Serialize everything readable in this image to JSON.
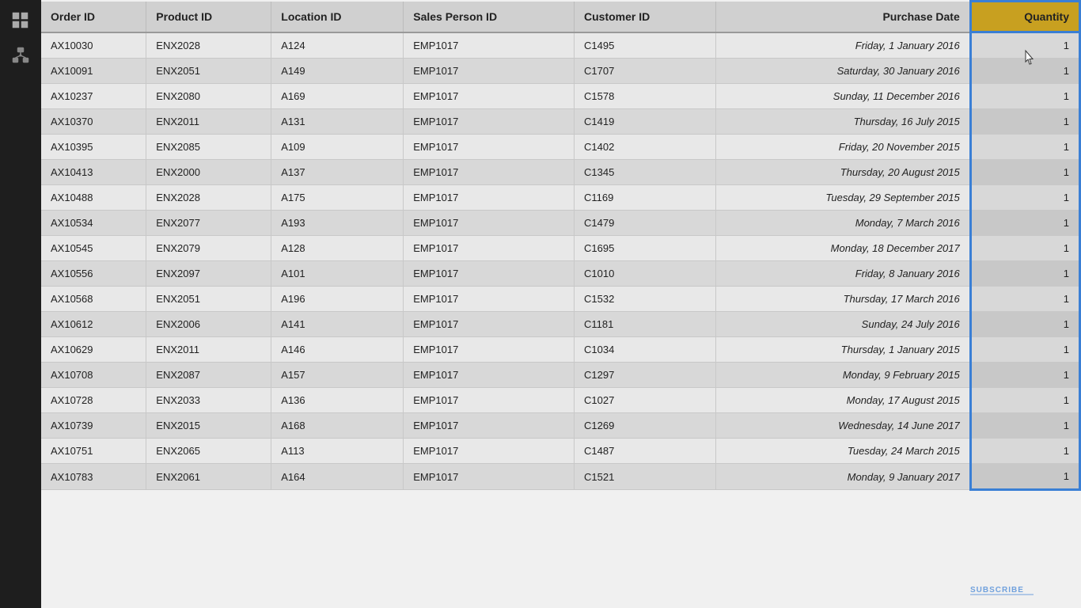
{
  "sidebar": {
    "icons": [
      {
        "name": "table-icon",
        "label": "Table View",
        "active": true
      },
      {
        "name": "network-icon",
        "label": "Network View",
        "active": false
      }
    ]
  },
  "table": {
    "columns": [
      {
        "key": "order_id",
        "label": "Order ID"
      },
      {
        "key": "product_id",
        "label": "Product ID"
      },
      {
        "key": "location_id",
        "label": "Location ID"
      },
      {
        "key": "sales_person_id",
        "label": "Sales Person ID"
      },
      {
        "key": "customer_id",
        "label": "Customer ID"
      },
      {
        "key": "purchase_date",
        "label": "Purchase Date"
      },
      {
        "key": "quantity",
        "label": "Quantity"
      }
    ],
    "rows": [
      {
        "order_id": "AX10030",
        "product_id": "ENX2028",
        "location_id": "A124",
        "sales_person_id": "EMP1017",
        "customer_id": "C1495",
        "purchase_date": "Friday, 1 January 2016",
        "quantity": "1"
      },
      {
        "order_id": "AX10091",
        "product_id": "ENX2051",
        "location_id": "A149",
        "sales_person_id": "EMP1017",
        "customer_id": "C1707",
        "purchase_date": "Saturday, 30 January 2016",
        "quantity": "1"
      },
      {
        "order_id": "AX10237",
        "product_id": "ENX2080",
        "location_id": "A169",
        "sales_person_id": "EMP1017",
        "customer_id": "C1578",
        "purchase_date": "Sunday, 11 December 2016",
        "quantity": "1"
      },
      {
        "order_id": "AX10370",
        "product_id": "ENX2011",
        "location_id": "A131",
        "sales_person_id": "EMP1017",
        "customer_id": "C1419",
        "purchase_date": "Thursday, 16 July 2015",
        "quantity": "1"
      },
      {
        "order_id": "AX10395",
        "product_id": "ENX2085",
        "location_id": "A109",
        "sales_person_id": "EMP1017",
        "customer_id": "C1402",
        "purchase_date": "Friday, 20 November 2015",
        "quantity": "1"
      },
      {
        "order_id": "AX10413",
        "product_id": "ENX2000",
        "location_id": "A137",
        "sales_person_id": "EMP1017",
        "customer_id": "C1345",
        "purchase_date": "Thursday, 20 August 2015",
        "quantity": "1"
      },
      {
        "order_id": "AX10488",
        "product_id": "ENX2028",
        "location_id": "A175",
        "sales_person_id": "EMP1017",
        "customer_id": "C1169",
        "purchase_date": "Tuesday, 29 September 2015",
        "quantity": "1"
      },
      {
        "order_id": "AX10534",
        "product_id": "ENX2077",
        "location_id": "A193",
        "sales_person_id": "EMP1017",
        "customer_id": "C1479",
        "purchase_date": "Monday, 7 March 2016",
        "quantity": "1"
      },
      {
        "order_id": "AX10545",
        "product_id": "ENX2079",
        "location_id": "A128",
        "sales_person_id": "EMP1017",
        "customer_id": "C1695",
        "purchase_date": "Monday, 18 December 2017",
        "quantity": "1"
      },
      {
        "order_id": "AX10556",
        "product_id": "ENX2097",
        "location_id": "A101",
        "sales_person_id": "EMP1017",
        "customer_id": "C1010",
        "purchase_date": "Friday, 8 January 2016",
        "quantity": "1"
      },
      {
        "order_id": "AX10568",
        "product_id": "ENX2051",
        "location_id": "A196",
        "sales_person_id": "EMP1017",
        "customer_id": "C1532",
        "purchase_date": "Thursday, 17 March 2016",
        "quantity": "1"
      },
      {
        "order_id": "AX10612",
        "product_id": "ENX2006",
        "location_id": "A141",
        "sales_person_id": "EMP1017",
        "customer_id": "C1181",
        "purchase_date": "Sunday, 24 July 2016",
        "quantity": "1"
      },
      {
        "order_id": "AX10629",
        "product_id": "ENX2011",
        "location_id": "A146",
        "sales_person_id": "EMP1017",
        "customer_id": "C1034",
        "purchase_date": "Thursday, 1 January 2015",
        "quantity": "1"
      },
      {
        "order_id": "AX10708",
        "product_id": "ENX2087",
        "location_id": "A157",
        "sales_person_id": "EMP1017",
        "customer_id": "C1297",
        "purchase_date": "Monday, 9 February 2015",
        "quantity": "1"
      },
      {
        "order_id": "AX10728",
        "product_id": "ENX2033",
        "location_id": "A136",
        "sales_person_id": "EMP1017",
        "customer_id": "C1027",
        "purchase_date": "Monday, 17 August 2015",
        "quantity": "1"
      },
      {
        "order_id": "AX10739",
        "product_id": "ENX2015",
        "location_id": "A168",
        "sales_person_id": "EMP1017",
        "customer_id": "C1269",
        "purchase_date": "Wednesday, 14 June 2017",
        "quantity": "1"
      },
      {
        "order_id": "AX10751",
        "product_id": "ENX2065",
        "location_id": "A113",
        "sales_person_id": "EMP1017",
        "customer_id": "C1487",
        "purchase_date": "Tuesday, 24 March 2015",
        "quantity": "1"
      },
      {
        "order_id": "AX10783",
        "product_id": "ENX2061",
        "location_id": "A164",
        "sales_person_id": "EMP1017",
        "customer_id": "C1521",
        "purchase_date": "Monday, 9 January 2017",
        "quantity": "1"
      }
    ]
  },
  "watermark": {
    "text": "SUBSCRIBE",
    "color": "#3a7fd5"
  }
}
